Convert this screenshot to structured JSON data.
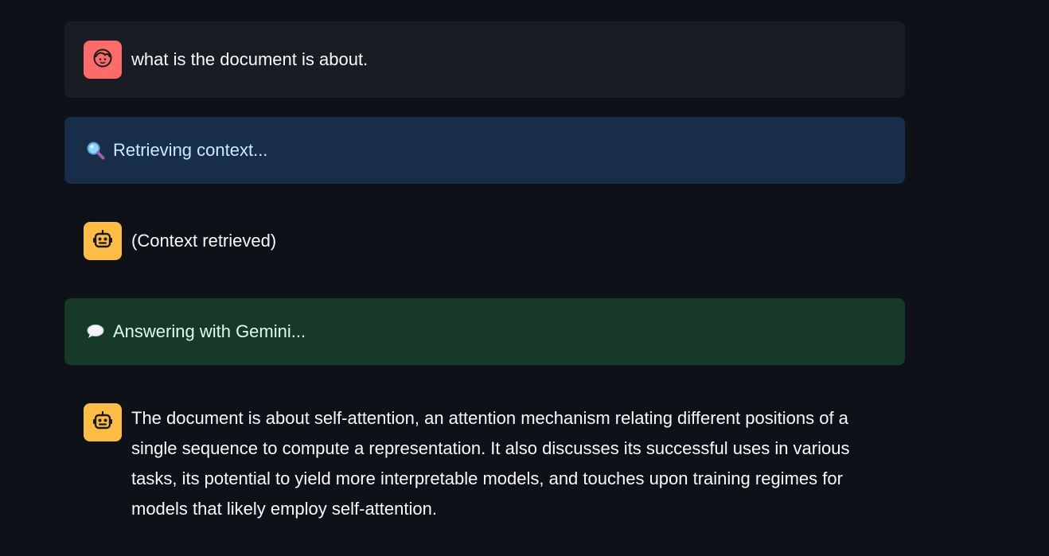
{
  "chat": {
    "user_message": {
      "avatar_icon": "user-face-icon",
      "text": "what is the document is about."
    },
    "status_retrieving": {
      "icon": "magnifying-glass-icon",
      "text": "Retrieving context..."
    },
    "assistant_context": {
      "avatar_icon": "robot-icon",
      "text": "(Context retrieved)"
    },
    "status_answering": {
      "icon": "speech-balloon-icon",
      "text": "Answering with Gemini..."
    },
    "assistant_answer": {
      "avatar_icon": "robot-icon",
      "text": "The document is about self-attention, an attention mechanism relating different positions of a single sequence to compute a representation. It also discusses its successful uses in various tasks, its potential to yield more interpretable models, and touches upon training regimes for models that likely employ self-attention."
    }
  },
  "colors": {
    "background": "#0e1117",
    "user_bubble": "#1a1c24",
    "user_avatar": "#ff6b6b",
    "bot_avatar": "#ffbd45",
    "info_bg": "#172d48",
    "info_text": "#c7ebff",
    "success_bg": "#173928",
    "success_text": "#dffde9"
  }
}
